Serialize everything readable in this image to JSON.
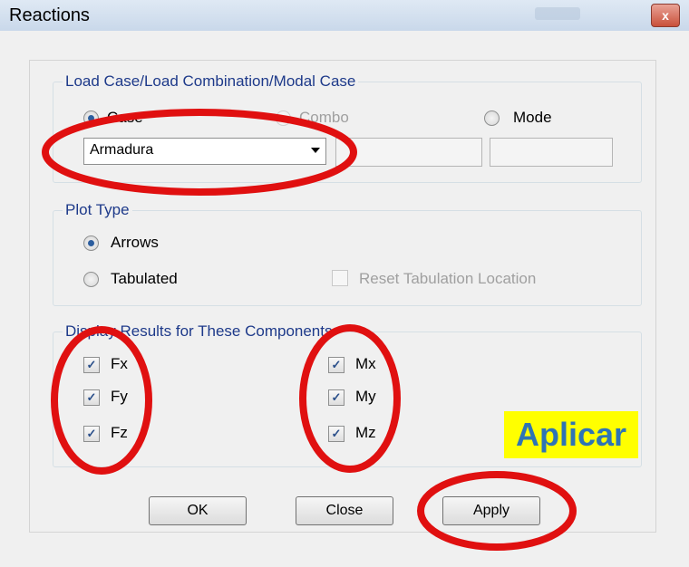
{
  "window": {
    "title": "Reactions",
    "close_label": "x"
  },
  "load_group": {
    "title": "Load Case/Load Combination/Modal Case",
    "options": {
      "case": "Case",
      "combo": "Combo",
      "mode": "Mode"
    },
    "selected": "case",
    "case_value": "Armadura"
  },
  "plot_group": {
    "title": "Plot Type",
    "arrows": "Arrows",
    "tabulated": "Tabulated",
    "reset": "Reset Tabulation Location",
    "selected": "arrows"
  },
  "components_group": {
    "title": "Display Results for These Components",
    "items": [
      {
        "label": "Fx",
        "checked": true
      },
      {
        "label": "Fy",
        "checked": true
      },
      {
        "label": "Fz",
        "checked": true
      },
      {
        "label": "Mx",
        "checked": true
      },
      {
        "label": "My",
        "checked": true
      },
      {
        "label": "Mz",
        "checked": true
      }
    ]
  },
  "buttons": {
    "ok": "OK",
    "close": "Close",
    "apply": "Apply"
  },
  "annotation": {
    "text": "Aplicar",
    "highlight_color": "#ffff00",
    "circle_color": "#e01010"
  }
}
